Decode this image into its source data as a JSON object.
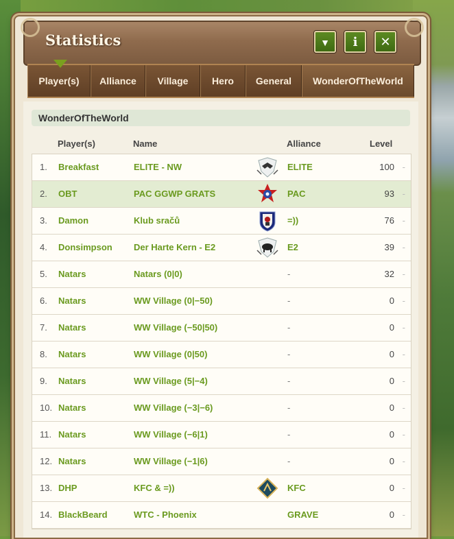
{
  "window": {
    "title": "Statistics"
  },
  "title_buttons": [
    {
      "icon": "chevron-down-icon",
      "glyph": "▼"
    },
    {
      "icon": "info-icon",
      "glyph": "i"
    },
    {
      "icon": "close-icon",
      "glyph": "✕"
    }
  ],
  "tabs": [
    "Player(s)",
    "Alliance",
    "Village",
    "Hero",
    "General",
    "WonderOfTheWorld"
  ],
  "active_tab": "WonderOfTheWorld",
  "section_title": "WonderOfTheWorld",
  "columns": {
    "player": "Player(s)",
    "name": "Name",
    "alliance": "Alliance",
    "level": "Level"
  },
  "rows": [
    {
      "rank": "1.",
      "player": "Breakfast",
      "name": "ELITE - NW",
      "alliance": "ELITE",
      "level": "100",
      "crest": "wings"
    },
    {
      "rank": "2.",
      "player": "OBT",
      "name": "PAC GGWP GRATS",
      "alliance": "PAC",
      "level": "93",
      "crest": "red-star"
    },
    {
      "rank": "3.",
      "player": "Damon",
      "name": "Klub sračů",
      "alliance": "=))",
      "level": "76",
      "crest": "skull-shield"
    },
    {
      "rank": "4.",
      "player": "Donsimpson",
      "name": "Der Harte Kern - E2",
      "alliance": "E2",
      "level": "39",
      "crest": "boar"
    },
    {
      "rank": "5.",
      "player": "Natars",
      "name": "Natars (0|0)",
      "alliance": "-",
      "level": "32",
      "crest": ""
    },
    {
      "rank": "6.",
      "player": "Natars",
      "name": "WW Village (0|−50)",
      "alliance": "-",
      "level": "0",
      "crest": ""
    },
    {
      "rank": "7.",
      "player": "Natars",
      "name": "WW Village (−50|50)",
      "alliance": "-",
      "level": "0",
      "crest": ""
    },
    {
      "rank": "8.",
      "player": "Natars",
      "name": "WW Village (0|50)",
      "alliance": "-",
      "level": "0",
      "crest": ""
    },
    {
      "rank": "9.",
      "player": "Natars",
      "name": "WW Village (5|−4)",
      "alliance": "-",
      "level": "0",
      "crest": ""
    },
    {
      "rank": "10.",
      "player": "Natars",
      "name": "WW Village (−3|−6)",
      "alliance": "-",
      "level": "0",
      "crest": ""
    },
    {
      "rank": "11.",
      "player": "Natars",
      "name": "WW Village (−6|1)",
      "alliance": "-",
      "level": "0",
      "crest": ""
    },
    {
      "rank": "12.",
      "player": "Natars",
      "name": "WW Village (−1|6)",
      "alliance": "-",
      "level": "0",
      "crest": ""
    },
    {
      "rank": "13.",
      "player": "DHP",
      "name": "KFC & =))",
      "alliance": "KFC",
      "level": "0",
      "crest": "teal-diamond"
    },
    {
      "rank": "14.",
      "player": "BlackBeard",
      "name": "WTC - Phoenix",
      "alliance": "GRAVE",
      "level": "0",
      "crest": ""
    }
  ],
  "highlighted_rank": "2."
}
